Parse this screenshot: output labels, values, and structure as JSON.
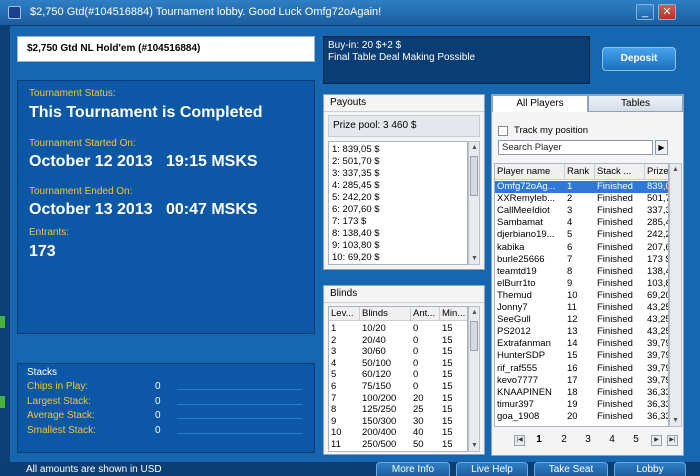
{
  "window": {
    "title": "$2,750 Gtd(#104516884) Tournament lobby. Good Luck Omfg72oAgain!"
  },
  "tournament": {
    "name": "$2,750 Gtd NL Hold'em (#104516884)",
    "status_label": "Tournament Status:",
    "status_value": "This Tournament is Completed",
    "started_label": "Tournament Started On:",
    "started_value": "October 12 2013   19:15 MSKS",
    "ended_label": "Tournament Ended On:",
    "ended_value": "October 13 2013   00:47 MSKS",
    "entrants_label": "Entrants:",
    "entrants_value": "173"
  },
  "buyin": {
    "line1": "Buy-in: 20 $+2 $",
    "line2": "Final Table Deal Making Possible"
  },
  "deposit_label": "Deposit",
  "stacks": {
    "title": "Stacks",
    "rows": [
      {
        "label": "Chips in Play:",
        "value": "0"
      },
      {
        "label": "Largest Stack:",
        "value": "0"
      },
      {
        "label": "Average Stack:",
        "value": "0"
      },
      {
        "label": "Smallest Stack:",
        "value": "0"
      }
    ]
  },
  "payouts": {
    "title": "Payouts",
    "prize_pool": "Prize pool: 3 460 $",
    "items": [
      "1: 839,05 $",
      "2: 501,70 $",
      "3: 337,35 $",
      "4: 285,45 $",
      "5: 242,20 $",
      "6: 207,60 $",
      "7: 173 $",
      "8: 138,40 $",
      "9: 103,80 $",
      "10: 69,20 $"
    ]
  },
  "blinds": {
    "title": "Blinds",
    "headers": [
      "Lev...",
      "Blinds",
      "Ant...",
      "Min..."
    ],
    "rows": [
      [
        "1",
        "10/20",
        "0",
        "15"
      ],
      [
        "2",
        "20/40",
        "0",
        "15"
      ],
      [
        "3",
        "30/60",
        "0",
        "15"
      ],
      [
        "4",
        "50/100",
        "0",
        "15"
      ],
      [
        "5",
        "60/120",
        "0",
        "15"
      ],
      [
        "6",
        "75/150",
        "0",
        "15"
      ],
      [
        "7",
        "100/200",
        "20",
        "15"
      ],
      [
        "8",
        "125/250",
        "25",
        "15"
      ],
      [
        "9",
        "150/300",
        "30",
        "15"
      ],
      [
        "10",
        "200/400",
        "40",
        "15"
      ],
      [
        "11",
        "250/500",
        "50",
        "15"
      ]
    ]
  },
  "players": {
    "tab_all": "All Players",
    "tab_tables": "Tables",
    "track_label": "Track my position",
    "search_placeholder": "Search Player",
    "headers": [
      "Player name",
      "Rank",
      "Stack ...",
      "Prize"
    ],
    "rows": [
      [
        "Omfg72oAg...",
        "1",
        "Finished",
        "839,0..."
      ],
      [
        "XXRemyleb...",
        "2",
        "Finished",
        "501,7..."
      ],
      [
        "CallMeeIdiot",
        "3",
        "Finished",
        "337,3..."
      ],
      [
        "Sambamat",
        "4",
        "Finished",
        "285,4..."
      ],
      [
        "djerbiano19...",
        "5",
        "Finished",
        "242,2..."
      ],
      [
        "kabika",
        "6",
        "Finished",
        "207,6..."
      ],
      [
        "burle25666",
        "7",
        "Finished",
        "173 $"
      ],
      [
        "teamtd19",
        "8",
        "Finished",
        "138,4..."
      ],
      [
        "elBurr1to",
        "9",
        "Finished",
        "103,8..."
      ],
      [
        "Themud",
        "10",
        "Finished",
        "69,20 $"
      ],
      [
        "Jonny7",
        "11",
        "Finished",
        "43,25 $"
      ],
      [
        "SeeGull",
        "12",
        "Finished",
        "43,25 $"
      ],
      [
        "PS2012",
        "13",
        "Finished",
        "43,25 $"
      ],
      [
        "Extrafanman",
        "14",
        "Finished",
        "39,79 $"
      ],
      [
        "HunterSDP",
        "15",
        "Finished",
        "39,79 $"
      ],
      [
        "rif_raf555",
        "16",
        "Finished",
        "39,79 $"
      ],
      [
        "kevo7777",
        "17",
        "Finished",
        "39,79 $"
      ],
      [
        "KNAAPINEN",
        "18",
        "Finished",
        "36,33 $"
      ],
      [
        "timur397",
        "19",
        "Finished",
        "36,33 $"
      ],
      [
        "goa_1908",
        "20",
        "Finished",
        "36,33 $"
      ]
    ],
    "pages": [
      "1",
      "2",
      "3",
      "4",
      "5"
    ]
  },
  "footer": {
    "note": "All amounts are shown in USD",
    "more_info": "More Info",
    "live_help": "Live Help",
    "take_seat": "Take Seat",
    "lobby": "Lobby"
  },
  "colors": {
    "label_yellow": "#f2c53a",
    "panel_blue": "#0c57a6",
    "selected_row": "#2f78d5"
  }
}
